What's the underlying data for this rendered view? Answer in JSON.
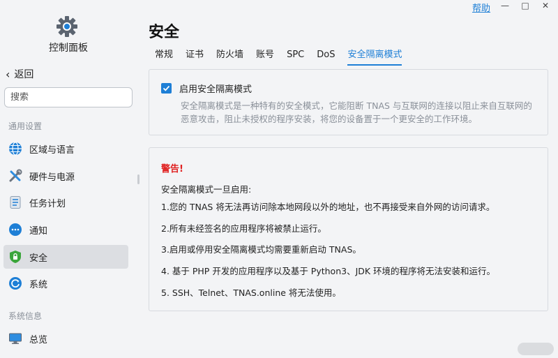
{
  "window": {
    "help": "帮助",
    "minimize": "—",
    "maximize": "□",
    "close": "✕"
  },
  "sidebar": {
    "app_title": "控制面板",
    "back_label": "返回",
    "search_placeholder": "搜索",
    "section_general": "通用设置",
    "section_info": "系统信息",
    "items": [
      {
        "label": "区域与语言",
        "icon": "globe-icon"
      },
      {
        "label": "硬件与电源",
        "icon": "tools-icon"
      },
      {
        "label": "任务计划",
        "icon": "task-icon"
      },
      {
        "label": "通知",
        "icon": "chat-icon"
      },
      {
        "label": "安全",
        "icon": "shield-icon"
      },
      {
        "label": "系统",
        "icon": "system-icon"
      },
      {
        "label": "总览",
        "icon": "monitor-icon"
      }
    ],
    "active": "安全"
  },
  "main": {
    "title": "安全",
    "tabs": [
      "常规",
      "证书",
      "防火墙",
      "账号",
      "SPC",
      "DoS",
      "安全隔离模式"
    ],
    "active_tab": "安全隔离模式",
    "isolation": {
      "checkbox_label": "启用安全隔离模式",
      "checked": true,
      "description": "安全隔离模式是一种特有的安全模式，它能阻断 TNAS 与互联网的连接以阻止来自互联网的恶意攻击，阻止未授权的程序安装，将您的设备置于一个更安全的工作环境。"
    },
    "warning": {
      "title": "警告!",
      "intro": "安全隔离模式一旦启用:",
      "items": [
        "1.您的 TNAS 将无法再访问除本地网段以外的地址，也不再接受来自外网的访问请求。",
        "2.所有未经签名的应用程序将被禁止运行。",
        "3.启用或停用安全隔离模式均需要重新启动 TNAS。",
        "4. 基于 PHP 开发的应用程序以及基于 Python3、JDK 环境的程序将无法安装和运行。",
        "5. SSH、Telnet、TNAS.online 将无法使用。"
      ]
    }
  },
  "colors": {
    "accent": "#1e7fd6",
    "warning": "#e02020"
  }
}
